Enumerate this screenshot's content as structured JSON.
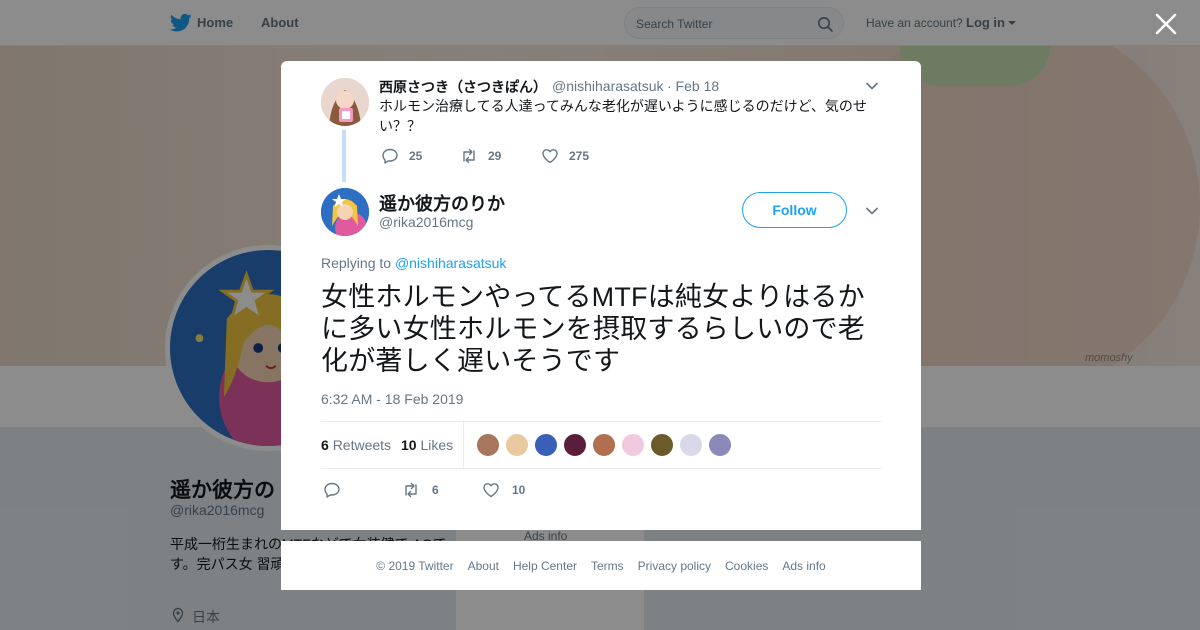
{
  "nav": {
    "home": "Home",
    "about": "About",
    "search_placeholder": "Search Twitter",
    "have_account": "Have an account?",
    "login": "Log in"
  },
  "profile": {
    "name": "遥か彼方の",
    "handle": "@rika2016mcg",
    "bio": "平成一桁生まれのMTFなどで女装健で AGです。完パス女 習頑張ってます。",
    "location": "日本",
    "banner_tag": "momoshy",
    "side_ads": "Ads info"
  },
  "parent_tweet": {
    "name": "西原さつき（さつきぽん）",
    "handle": "@nishiharasatsuk",
    "date": "· Feb 18",
    "text": "ホルモン治療してる人達ってみんな老化が遅いように感じるのだけど、気のせい？？",
    "replies": "25",
    "retweets": "29",
    "likes": "275"
  },
  "tweet": {
    "name": "遥か彼方のりか",
    "handle": "@rika2016mcg",
    "follow": "Follow",
    "replying_label": "Replying to",
    "replying_handle": "@nishiharasatsuk",
    "text": "女性ホルモンやってるMTFは純女よりはるかに多い女性ホルモンを摂取するらしいので老化が著しく遅いそうです",
    "time": "6:32 AM - 18 Feb 2019",
    "retweet_count": "6",
    "retweet_label": "Retweets",
    "like_count": "10",
    "like_label": "Likes",
    "action_retweets": "6",
    "action_likes": "10"
  },
  "likers": [
    {
      "color": "#a8765c"
    },
    {
      "color": "#e8c9a0"
    },
    {
      "color": "#3a5fb8"
    },
    {
      "color": "#5a1e3c"
    },
    {
      "color": "#b07050"
    },
    {
      "color": "#f0c8e0"
    },
    {
      "color": "#6b5a2a"
    },
    {
      "color": "#d8d8e8"
    },
    {
      "color": "#8a8ab8"
    }
  ],
  "footer": {
    "copyright": "© 2019 Twitter",
    "about": "About",
    "help": "Help Center",
    "terms": "Terms",
    "privacy": "Privacy policy",
    "cookies": "Cookies",
    "ads": "Ads info"
  },
  "colors": {
    "accent": "#1da1f2",
    "muted": "#657786"
  }
}
